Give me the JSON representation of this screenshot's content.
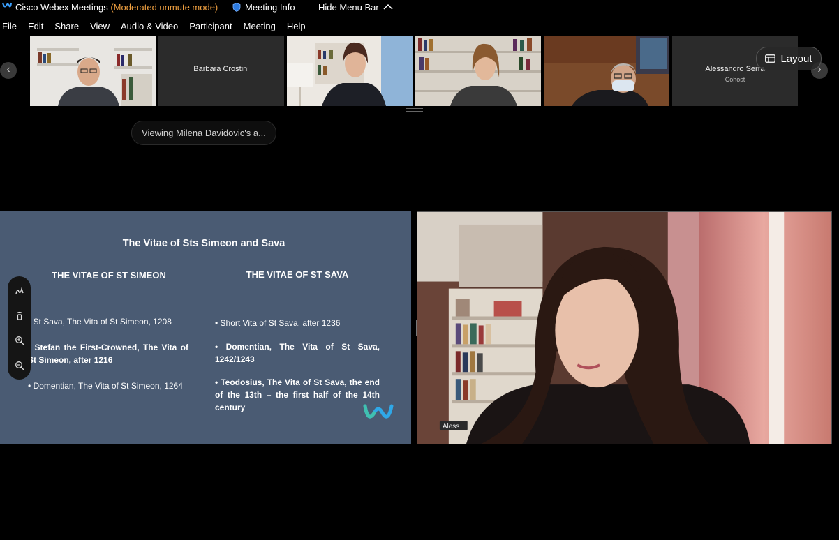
{
  "titlebar": {
    "app_name": "Cisco Webex Meetings",
    "mode": "(Moderated unmute mode)",
    "meeting_info": "Meeting Info",
    "hide_menu": "Hide Menu Bar"
  },
  "menu": [
    "File",
    "Edit",
    "Share",
    "View",
    "Audio & Video",
    "Participant",
    "Meeting",
    "Help"
  ],
  "participants": [
    {
      "name": "",
      "role": "",
      "video": true
    },
    {
      "name": "Barbara Crostini",
      "role": "",
      "video": false
    },
    {
      "name": "",
      "role": "",
      "video": true
    },
    {
      "name": "",
      "role": "",
      "video": true
    },
    {
      "name": "",
      "role": "",
      "video": true
    },
    {
      "name": "Alessandro Serra",
      "role": "Cohost",
      "video": false
    }
  ],
  "layout_button": "Layout",
  "viewing_status": "Viewing Milena Davidovic's a...",
  "slide": {
    "title": "The Vitae of Sts Simeon and Sava",
    "left_heading": "THE VITAE OF ST SIMEON",
    "right_heading": "THE VITAE OF ST SAVA",
    "left_items": [
      "• St Sava, The Vita of St Simeon, 1208",
      "• Stefan the First-Crowned, The Vita of St Simeon, after 1216",
      "• Domentian, The Vita of St Simeon, 1264"
    ],
    "right_items": [
      "• Short Vita of St Sava, after 1236",
      "• Domentian, The Vita of St Sava, 1242/1243",
      "• Teodosius, The Vita of St Sava, the end of the 13th – the first half of the 14th century"
    ]
  },
  "video_name_tag": "Aless",
  "colors": {
    "accent_mode": "#f0a040",
    "slide_bg": "#4a5b73",
    "tile_bg": "#2b2b2b"
  },
  "icons": [
    "webex-logo-icon",
    "shield-icon",
    "chevron-up-icon",
    "chevron-left-icon",
    "chevron-right-icon",
    "layout-icon",
    "annotate-pen-icon",
    "pointer-icon",
    "zoom-in-icon",
    "zoom-out-icon"
  ]
}
